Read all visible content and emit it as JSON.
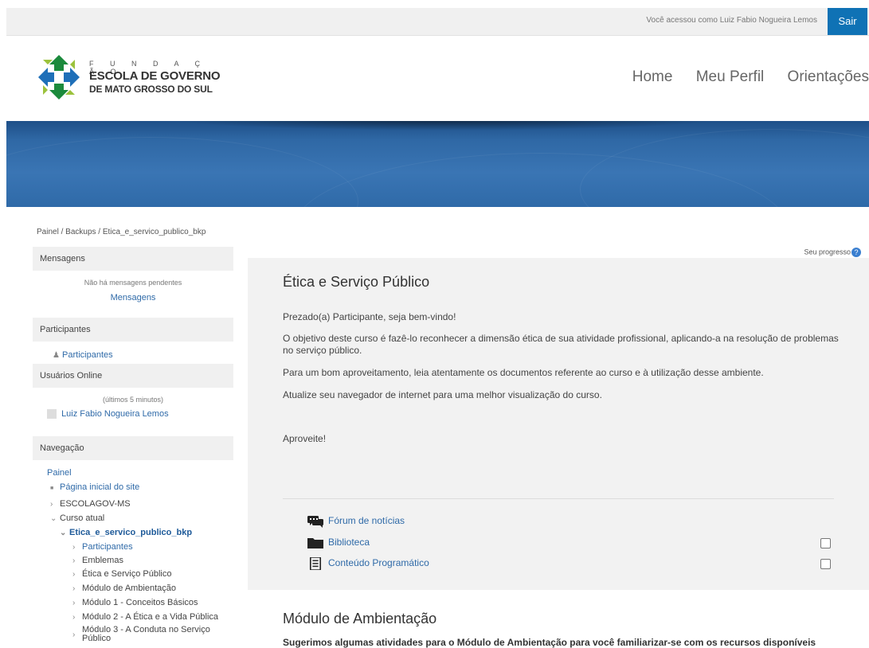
{
  "topbar": {
    "user_info": "Você acessou como Luiz Fabio Nogueira Lemos",
    "logout_label": "Sair"
  },
  "logo": {
    "line0": "F U N D A Ç Ã O",
    "line1": "ESCOLA DE GOVERNO",
    "line2": "DE MATO GROSSO DO SUL"
  },
  "nav": {
    "home": "Home",
    "profile": "Meu Perfil",
    "guidelines": "Orientações"
  },
  "breadcrumb": {
    "items": [
      "Painel",
      "Backups",
      "Etica_e_servico_publico_bkp"
    ],
    "sep": " / "
  },
  "blocks": {
    "messages": {
      "title": "Mensagens",
      "empty": "Não há mensagens pendentes",
      "link": "Mensagens"
    },
    "participants": {
      "title": "Participantes",
      "link": "Participantes"
    },
    "online": {
      "title": "Usuários Online",
      "note": "(últimos 5 minutos)",
      "user": "Luiz Fabio Nogueira Lemos"
    },
    "navigation": {
      "title": "Navegação",
      "items": [
        "Painel",
        "Página inicial do site",
        "ESCOLAGOV-MS",
        "Curso atual",
        "Etica_e_servico_publico_bkp",
        "Participantes",
        "Emblemas",
        "Ética e Serviço Público",
        "Módulo de Ambientação",
        "Módulo 1 - Conceitos Básicos",
        "Módulo 2 - A Ética e a Vida Pública",
        "Módulo 3 - A Conduta no Serviço",
        "Público"
      ]
    }
  },
  "progress": {
    "label": "Seu progresso",
    "help": "?"
  },
  "course": {
    "title": "Ética e Serviço Público",
    "paragraphs": [
      "Prezado(a) Participante, seja bem-vindo!",
      "O objetivo deste curso é fazê-lo reconhecer a dimensão ética de sua atividade profissional, aplicando-a na resolução de problemas no serviço público.",
      "Para um bom aproveitamento, leia atentamente os documentos referente ao curso e à utilização desse ambiente.",
      "Atualize seu navegador de internet para uma melhor visualização do curso.",
      "Aproveite!"
    ],
    "activities": [
      {
        "label": "Fórum de notícias",
        "icon": "forum-icon"
      },
      {
        "label": "Biblioteca",
        "icon": "folder-icon"
      },
      {
        "label": "Conteúdo Programático",
        "icon": "document-icon"
      }
    ]
  },
  "section": {
    "title": "Módulo de Ambientação",
    "text": "Sugerimos algumas atividades para o Módulo de Ambientação para você familiarizar-se com os recursos disponíveis"
  }
}
